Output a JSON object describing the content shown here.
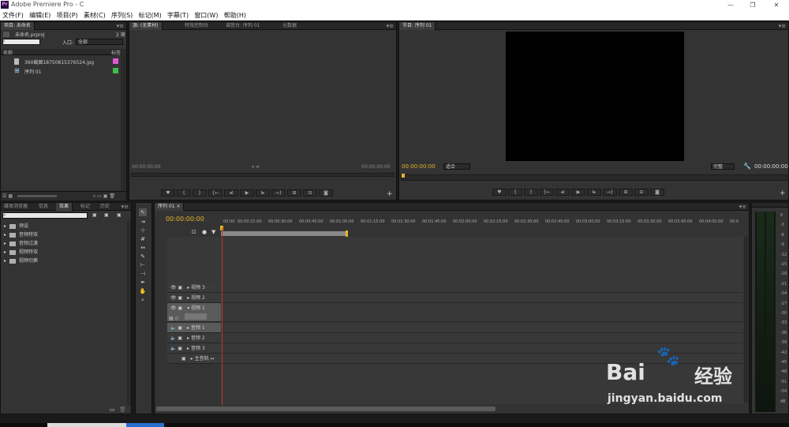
{
  "window": {
    "logo": "Pr",
    "title": "Adobe Premiere Pro - C"
  },
  "menu": [
    "文件(F)",
    "编辑(E)",
    "项目(P)",
    "素材(C)",
    "序列(S)",
    "标记(M)",
    "字幕(T)",
    "窗口(W)",
    "帮助(H)"
  ],
  "project_panel": {
    "tab": "项目: 未命名",
    "project_name": "未命名.prproj",
    "item_count": "2 项",
    "search_placeholder": "",
    "in_label": "入口:",
    "in_value": "全部",
    "col_name": "名称",
    "col_label": "标签",
    "items": [
      {
        "name": "360截图18750815376524.jpg",
        "color": "#e05ad2"
      },
      {
        "name": "序列 01",
        "color": "#3fbf4a"
      }
    ]
  },
  "source_panel": {
    "tabs": [
      "源: (无素材)",
      "特效控制台",
      "调音台: 序列 01",
      "元数据"
    ],
    "timecode_left": "00;00;00;00",
    "timecode_right": "00;00;00;00"
  },
  "program_panel": {
    "tab": "节目: 序列 01",
    "timecode_left": "00:00:00:00",
    "fit": "适合",
    "quality": "完整",
    "timecode_right": "00:00:00:00"
  },
  "effects_panel": {
    "tabs": [
      "媒体浏览器",
      "信息",
      "效果",
      "标记",
      "历史"
    ],
    "folders": [
      "预设",
      "音频特效",
      "音频过渡",
      "视频特效",
      "视频切换"
    ]
  },
  "timeline": {
    "tab": "序列 01",
    "timecode": "00:00:00:00",
    "ruler": [
      "00:00",
      "00:00:15:00",
      "00:00:30:00",
      "00:00:45:00",
      "00:01:00:00",
      "00:01:15:00",
      "00:01:30:00",
      "00:01:45:00",
      "00:02:00:00",
      "00:02:15:00",
      "00:02:30:00",
      "00:02:45:00",
      "00:03:00:00",
      "00:03:15:00",
      "00:03:30:00",
      "00:03:45:00",
      "00:04:00:00",
      "00:0"
    ],
    "tracks": [
      "视频 3",
      "视频 2",
      "视频 1",
      "音频 1",
      "音频 2",
      "音频 3",
      "主音轨"
    ]
  },
  "audio_meter": {
    "scale": [
      "0",
      "-3",
      "-6",
      "-9",
      "-12",
      "-15",
      "-18",
      "-21",
      "-24",
      "-27",
      "-30",
      "-33",
      "-36",
      "-39",
      "-42",
      "-45",
      "-48",
      "-51",
      "-54",
      "dB"
    ]
  },
  "watermark": {
    "brand": "Bai",
    "brand2": "经验",
    "url": "jingyan.baidu.com"
  }
}
